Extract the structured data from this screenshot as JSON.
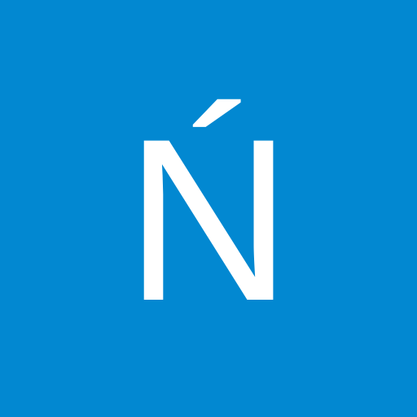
{
  "avatar": {
    "initial": "Ń",
    "background_color": "#0288d1",
    "text_color": "#ffffff"
  }
}
